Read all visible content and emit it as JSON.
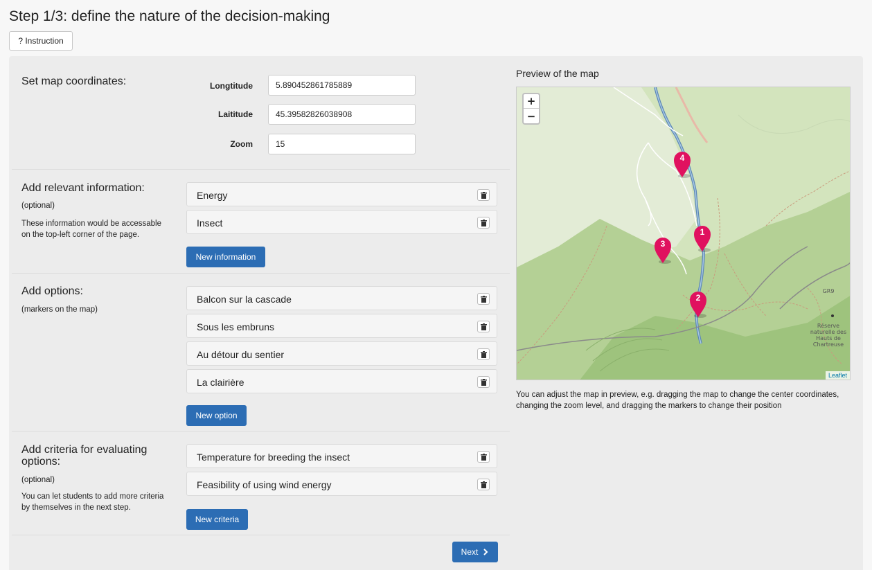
{
  "page": {
    "title": "Step 1/3: define the nature of the decision-making",
    "instruction_label": "? Instruction"
  },
  "coords": {
    "title": "Set map coordinates:",
    "longitude_label": "Longtitude",
    "longitude_value": "5.890452861785889",
    "latitude_label": "Laititude",
    "latitude_value": "45.39582826038908",
    "zoom_label": "Zoom",
    "zoom_value": "15"
  },
  "info": {
    "title": "Add relevant information:",
    "optional": "(optional)",
    "note": "These information would be accessable on the top-left corner of the page.",
    "items": [
      "Energy",
      "Insect"
    ],
    "button": "New information"
  },
  "options": {
    "title": "Add options:",
    "note": "(markers on the map)",
    "items": [
      "Balcon sur la cascade",
      "Sous les embruns",
      "Au détour du sentier",
      "La clairière"
    ],
    "button": "New option"
  },
  "criteria": {
    "title": "Add criteria for evaluating options:",
    "optional": "(optional)",
    "note": "You can let students to add more criteria by themselves in the next step.",
    "items": [
      "Temperature for breeding the insect",
      "Feasibility of using wind energy"
    ],
    "button": "New criteria"
  },
  "next_button": "Next",
  "preview": {
    "title": "Preview of the map",
    "zoom_in": "+",
    "zoom_out": "−",
    "attribution": "Leaflet",
    "map_labels": [
      "GR9",
      "Réserve",
      "naturelle des",
      "Hauts de",
      "Chartreuse"
    ],
    "markers": [
      "1",
      "2",
      "3",
      "4"
    ],
    "marker_color": "#e0115f",
    "help": "You can adjust the map in preview, e.g. dragging the map to change the center coordinates, changing the zoom level, and dragging the markers to change their position"
  },
  "icons": {
    "trash": "trash-icon",
    "next": "chevron-right-icon",
    "marker": "map-marker-icon"
  }
}
